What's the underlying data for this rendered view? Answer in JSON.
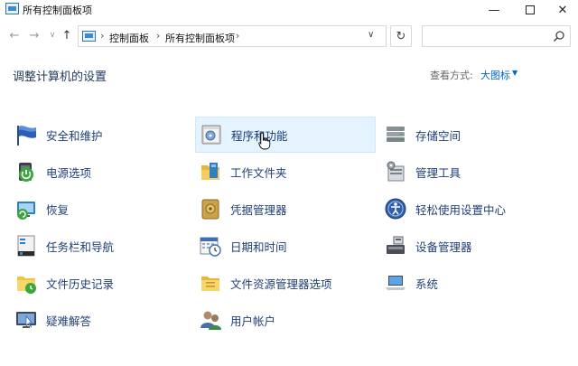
{
  "window": {
    "title": "所有控制面板项",
    "min_glyph": "—",
    "close_glyph": "✕"
  },
  "nav": {
    "back_glyph": "←",
    "forward_glyph": "→",
    "history_glyph": "∨",
    "up_glyph": "↑"
  },
  "address": {
    "sep1": "›",
    "crumb1": "控制面板",
    "sep2": "›",
    "crumb2": "所有控制面板项",
    "sep3": "›",
    "dropdown_glyph": "∨",
    "refresh_glyph": "↻"
  },
  "search": {
    "placeholder": ""
  },
  "header": {
    "title": "调整计算机的设置",
    "view_by_label": "查看方式:",
    "view_by_value": "大图标",
    "view_caret": "▼"
  },
  "items": [
    {
      "label": "安全和维护",
      "icon": "security-flag-icon"
    },
    {
      "label": "电源选项",
      "icon": "power-options-icon"
    },
    {
      "label": "恢复",
      "icon": "recovery-icon"
    },
    {
      "label": "任务栏和导航",
      "icon": "taskbar-icon"
    },
    {
      "label": "文件历史记录",
      "icon": "file-history-icon"
    },
    {
      "label": "疑难解答",
      "icon": "troubleshooting-icon"
    },
    {
      "label": "程序和功能",
      "icon": "programs-features-icon"
    },
    {
      "label": "工作文件夹",
      "icon": "work-folders-icon"
    },
    {
      "label": "凭据管理器",
      "icon": "credential-vault-icon"
    },
    {
      "label": "日期和时间",
      "icon": "calendar-clock-icon"
    },
    {
      "label": "文件资源管理器选项",
      "icon": "folder-options-icon"
    },
    {
      "label": "用户帐户",
      "icon": "user-accounts-icon"
    },
    {
      "label": "存储空间",
      "icon": "storage-drives-icon"
    },
    {
      "label": "管理工具",
      "icon": "admin-tools-icon"
    },
    {
      "label": "轻松使用设置中心",
      "icon": "ease-of-access-icon"
    },
    {
      "label": "设备管理器",
      "icon": "device-manager-icon"
    },
    {
      "label": "系统",
      "icon": "system-laptop-icon"
    }
  ]
}
